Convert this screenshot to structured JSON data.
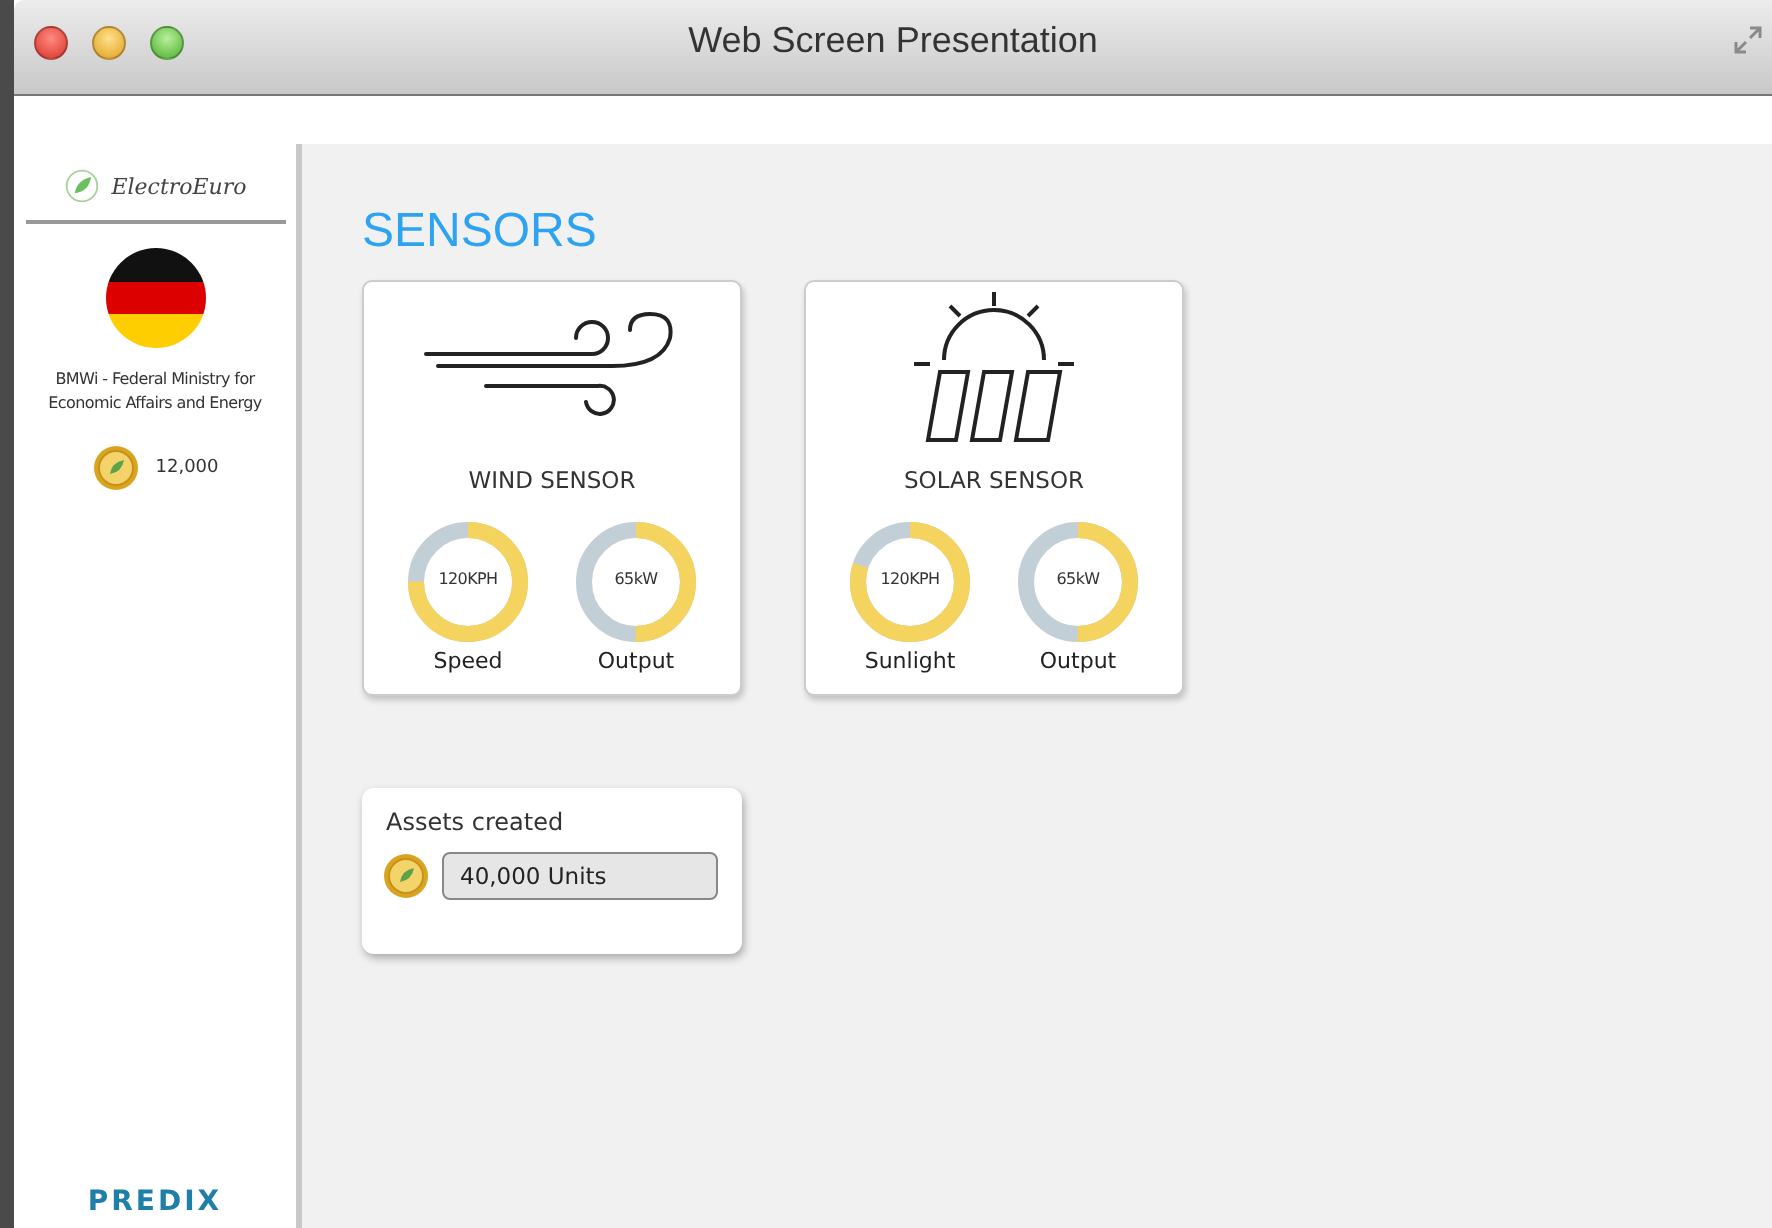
{
  "window": {
    "title": "Web Screen Presentation"
  },
  "sidebar": {
    "brand": "ElectroEuro",
    "organization": "BMWi - Federal Ministry for Economic Affairs and Energy",
    "balance": "12,000",
    "footer_logo": "PREDIX"
  },
  "heading": "SENSORS",
  "sensors": [
    {
      "kind": "wind",
      "title": "WIND SENSOR",
      "gauges": [
        {
          "reading": "120KPH",
          "label": "Speed",
          "level": 0.75
        },
        {
          "reading": "65kW",
          "label": "Output",
          "level": 0.5
        }
      ]
    },
    {
      "kind": "solar",
      "title": "SOLAR SENSOR",
      "gauges": [
        {
          "reading": "120KPH",
          "label": "Sunlight",
          "level": 0.8
        },
        {
          "reading": "65kW",
          "label": "Output",
          "level": 0.5
        }
      ]
    }
  ],
  "assets": {
    "title": "Assets created",
    "value": "40,000 Units"
  }
}
